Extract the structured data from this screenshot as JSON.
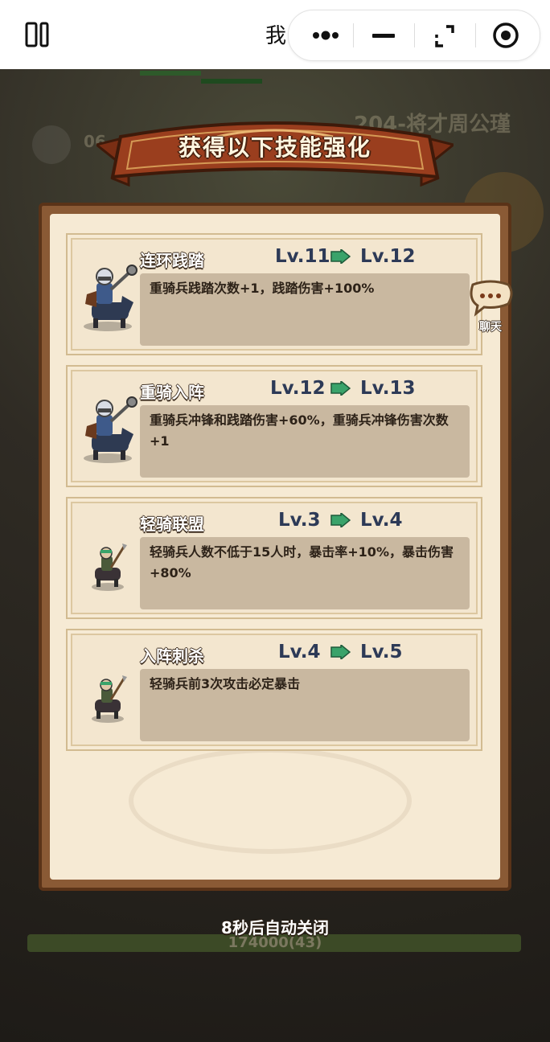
{
  "topbar": {
    "title": "我"
  },
  "background": {
    "game_title": "204-将才周公瑾",
    "timer": "06",
    "hp_text": "174000(43)"
  },
  "banner": {
    "title": "获得以下技能强化"
  },
  "skills": [
    {
      "name": "连环践踏",
      "lv_from": "Lv.11",
      "lv_to": "Lv.12",
      "desc": "重骑兵践踏次数+1，践踏伤害+100%",
      "unit": "heavy-cavalry"
    },
    {
      "name": "重骑入阵",
      "lv_from": "Lv.12",
      "lv_to": "Lv.13",
      "desc": "重骑兵冲锋和践踏伤害+60%，重骑兵冲锋伤害次数+1",
      "unit": "heavy-cavalry"
    },
    {
      "name": "轻骑联盟",
      "lv_from": "Lv.3",
      "lv_to": "Lv.4",
      "desc": "轻骑兵人数不低于15人时，暴击率+10%，暴击伤害+80%",
      "unit": "light-cavalry"
    },
    {
      "name": "入阵刺杀",
      "lv_from": "Lv.4",
      "lv_to": "Lv.5",
      "desc": "轻骑兵前3次攻击必定暴击",
      "unit": "light-cavalry"
    }
  ],
  "chat": {
    "label": "聊天"
  },
  "footer": {
    "auto_close": "8秒后自动关闭"
  },
  "colors": {
    "panel_bg": "#f6ead4",
    "desc_bg": "#c9b8a0",
    "level_text": "#2d3a57",
    "arrow": "#3aa36a",
    "banner": "#9a3e1e"
  }
}
